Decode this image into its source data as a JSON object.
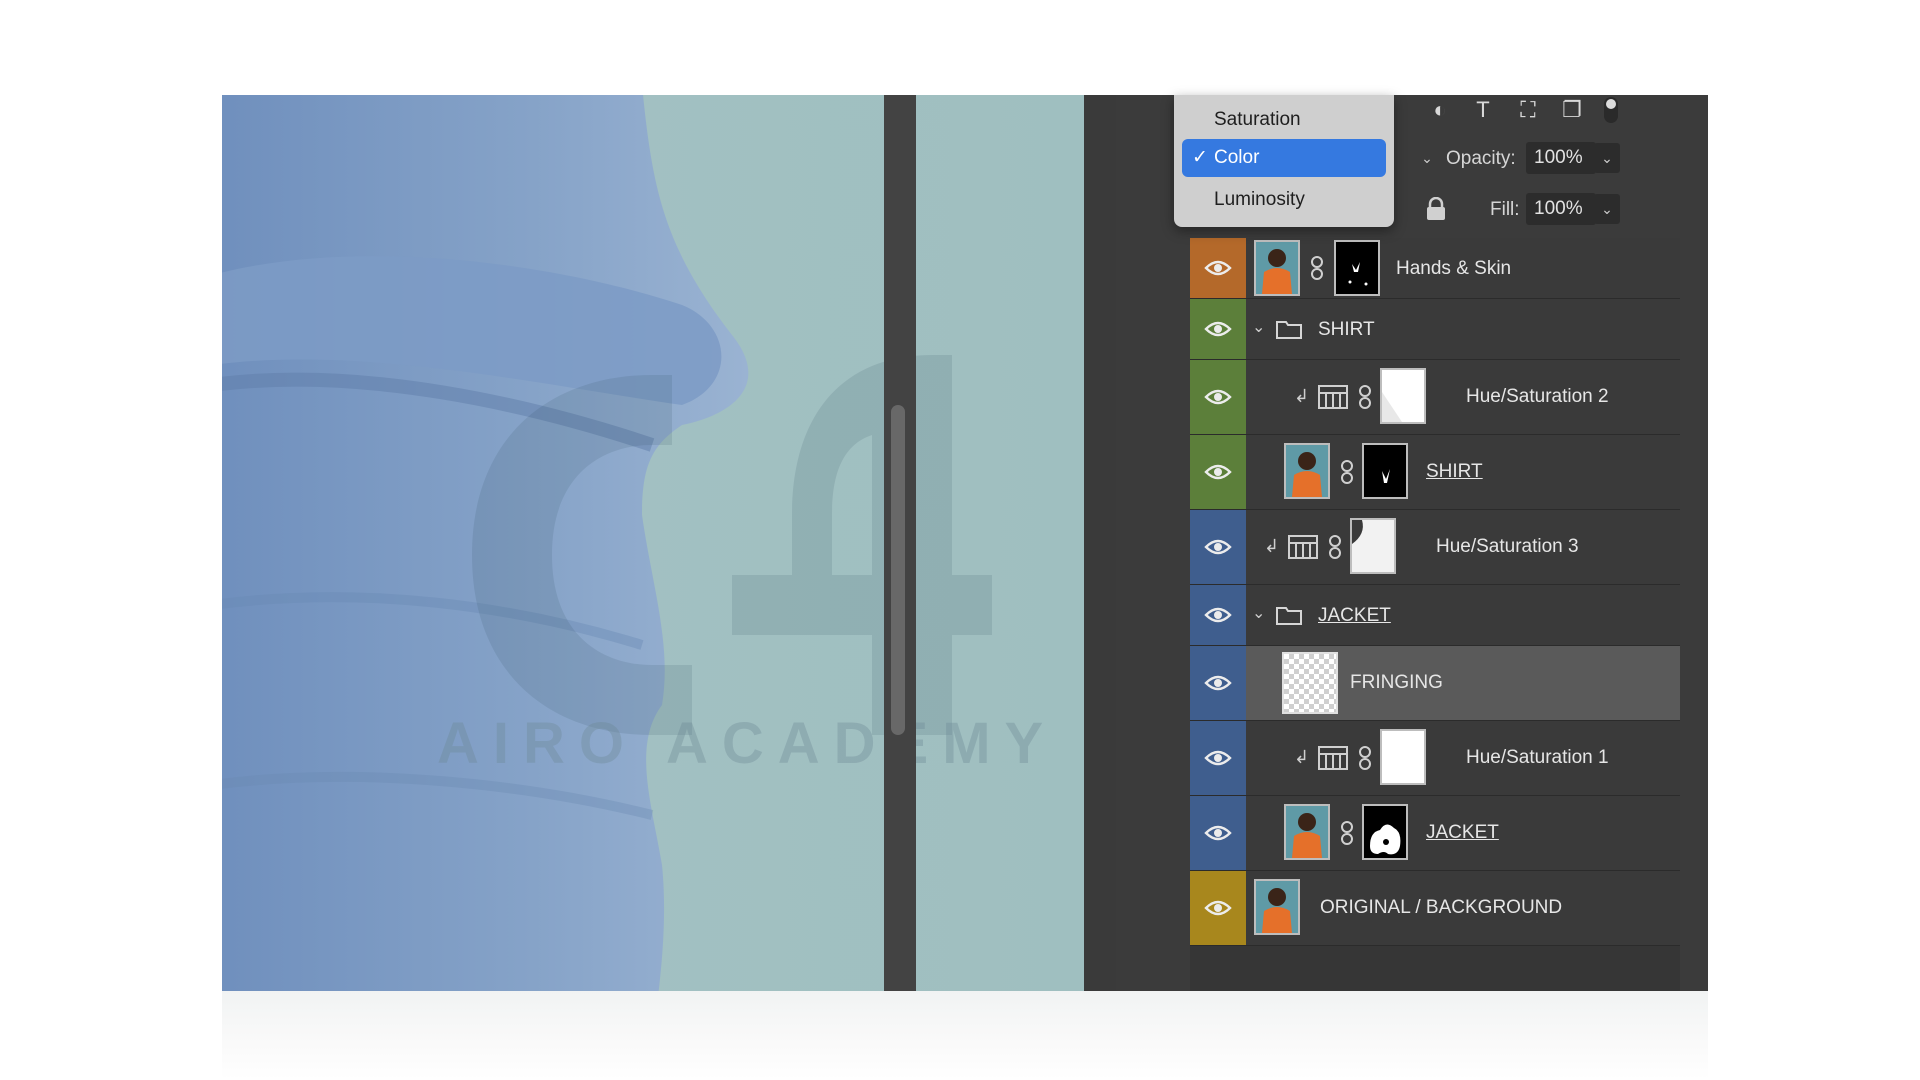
{
  "blend_menu": {
    "items": [
      {
        "label": "Saturation",
        "checked": false
      },
      {
        "label": "Color",
        "checked": true
      },
      {
        "label": "Luminosity",
        "checked": false
      }
    ],
    "check_glyph": "✓"
  },
  "properties": {
    "opacity_label": "Opacity:",
    "opacity_value": "100%",
    "fill_label": "Fill:",
    "fill_value": "100%"
  },
  "watermark": {
    "text": "AIRO ACADEMY"
  },
  "layers": [
    {
      "name": "Hands & Skin",
      "color": "#b4692a",
      "kind": "pixel-mask",
      "underline": false
    },
    {
      "name": "SHIRT",
      "color": "#5c7f3a",
      "kind": "group",
      "underline": false
    },
    {
      "name": "Hue/Saturation 2",
      "color": "#5c7f3a",
      "kind": "adjustment",
      "underline": false
    },
    {
      "name": "SHIRT",
      "color": "#5c7f3a",
      "kind": "pixel-mask",
      "underline": true
    },
    {
      "name": "Hue/Saturation 3",
      "color": "#3f5e8e",
      "kind": "adjustment",
      "underline": false
    },
    {
      "name": "JACKET",
      "color": "#3f5e8e",
      "kind": "group",
      "underline": true
    },
    {
      "name": "FRINGING",
      "color": "#3f5e8e",
      "kind": "empty",
      "underline": false,
      "selected": true
    },
    {
      "name": "Hue/Saturation 1",
      "color": "#3f5e8e",
      "kind": "adjustment",
      "underline": false
    },
    {
      "name": "JACKET",
      "color": "#3f5e8e",
      "kind": "pixel-mask",
      "underline": true
    },
    {
      "name": "ORIGINAL / BACKGROUND",
      "color": "#a8871d",
      "kind": "pixel",
      "underline": false
    }
  ],
  "colors": {
    "accent": "#3579e0",
    "panel": "#3b3b3b"
  }
}
